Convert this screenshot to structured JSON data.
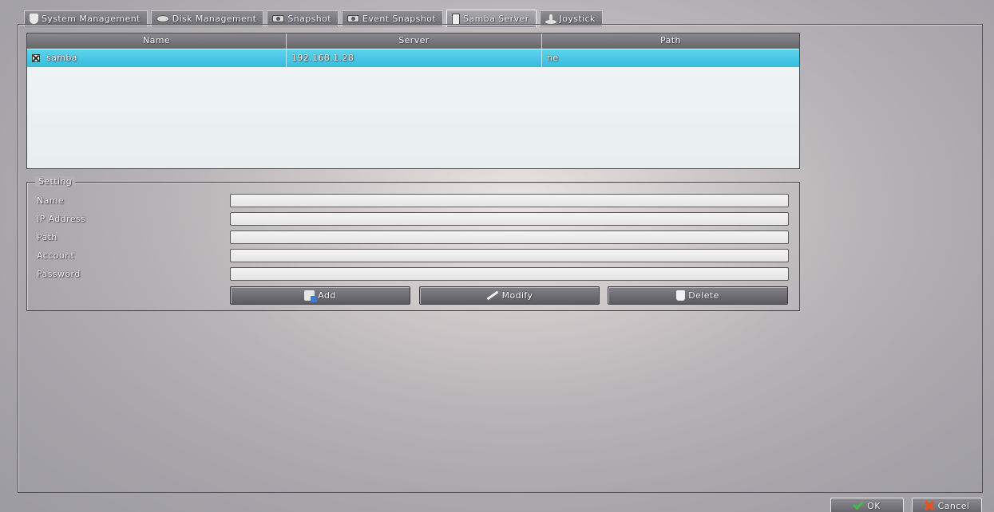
{
  "tabs": [
    {
      "label": "System Management",
      "icon": "shield-icon"
    },
    {
      "label": "Disk Management",
      "icon": "disk-icon"
    },
    {
      "label": "Snapshot",
      "icon": "camera-icon"
    },
    {
      "label": "Event Snapshot",
      "icon": "camera-icon"
    },
    {
      "label": "Samba Server",
      "icon": "server-icon",
      "active": true
    },
    {
      "label": "Joystick",
      "icon": "joystick-icon"
    }
  ],
  "table": {
    "headers": {
      "name": "Name",
      "server": "Server",
      "path": "Path"
    },
    "rows": [
      {
        "name": "samba",
        "server": "192.168.1.28",
        "path": "ne",
        "checked": true
      }
    ]
  },
  "setting": {
    "legend": "Setting",
    "fields": {
      "name": {
        "label": "Name",
        "value": ""
      },
      "ip": {
        "label": "IP Address",
        "value": ""
      },
      "path": {
        "label": "Path",
        "value": ""
      },
      "account": {
        "label": "Account",
        "value": ""
      },
      "password": {
        "label": "Password",
        "value": ""
      }
    },
    "buttons": {
      "add": "Add",
      "modify": "Modify",
      "delete": "Delete"
    }
  },
  "footer": {
    "ok": "OK",
    "cancel": "Cancel"
  },
  "colors": {
    "selected_row": "#35bde0",
    "ok_icon": "#3fc23f",
    "cancel_icon": "#e8541f"
  }
}
